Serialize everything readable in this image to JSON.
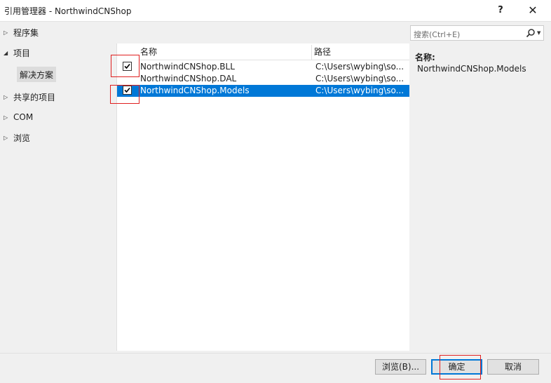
{
  "window": {
    "title": "引用管理器 - NorthwindCNShop",
    "help_label": "?",
    "close_label": "✕"
  },
  "sidebar": {
    "items": [
      {
        "label": "程序集",
        "expanded": false
      },
      {
        "label": "项目",
        "expanded": true
      },
      {
        "label": "共享的项目",
        "expanded": false
      },
      {
        "label": "COM",
        "expanded": false
      },
      {
        "label": "浏览",
        "expanded": false
      }
    ],
    "subitem": {
      "label": "解决方案",
      "selected": true
    }
  },
  "list": {
    "columns": {
      "name": "名称",
      "path": "路径"
    },
    "rows": [
      {
        "name": "NorthwindCNShop.BLL",
        "path": "C:\\Users\\wybing\\so...",
        "checked": true,
        "selected": false
      },
      {
        "name": "NorthwindCNShop.DAL",
        "path": "C:\\Users\\wybing\\so...",
        "checked": false,
        "selected": false
      },
      {
        "name": "NorthwindCNShop.Models",
        "path": "C:\\Users\\wybing\\so...",
        "checked": true,
        "selected": true
      }
    ]
  },
  "search": {
    "placeholder": "搜索(Ctrl+E)"
  },
  "details": {
    "label": "名称:",
    "value": "NorthwindCNShop.Models"
  },
  "buttons": {
    "browse": "浏览(B)...",
    "ok": "确定",
    "cancel": "取消"
  },
  "colors": {
    "selection": "#0078d7",
    "annotation": "#e02020",
    "background": "#f0f0f0"
  }
}
